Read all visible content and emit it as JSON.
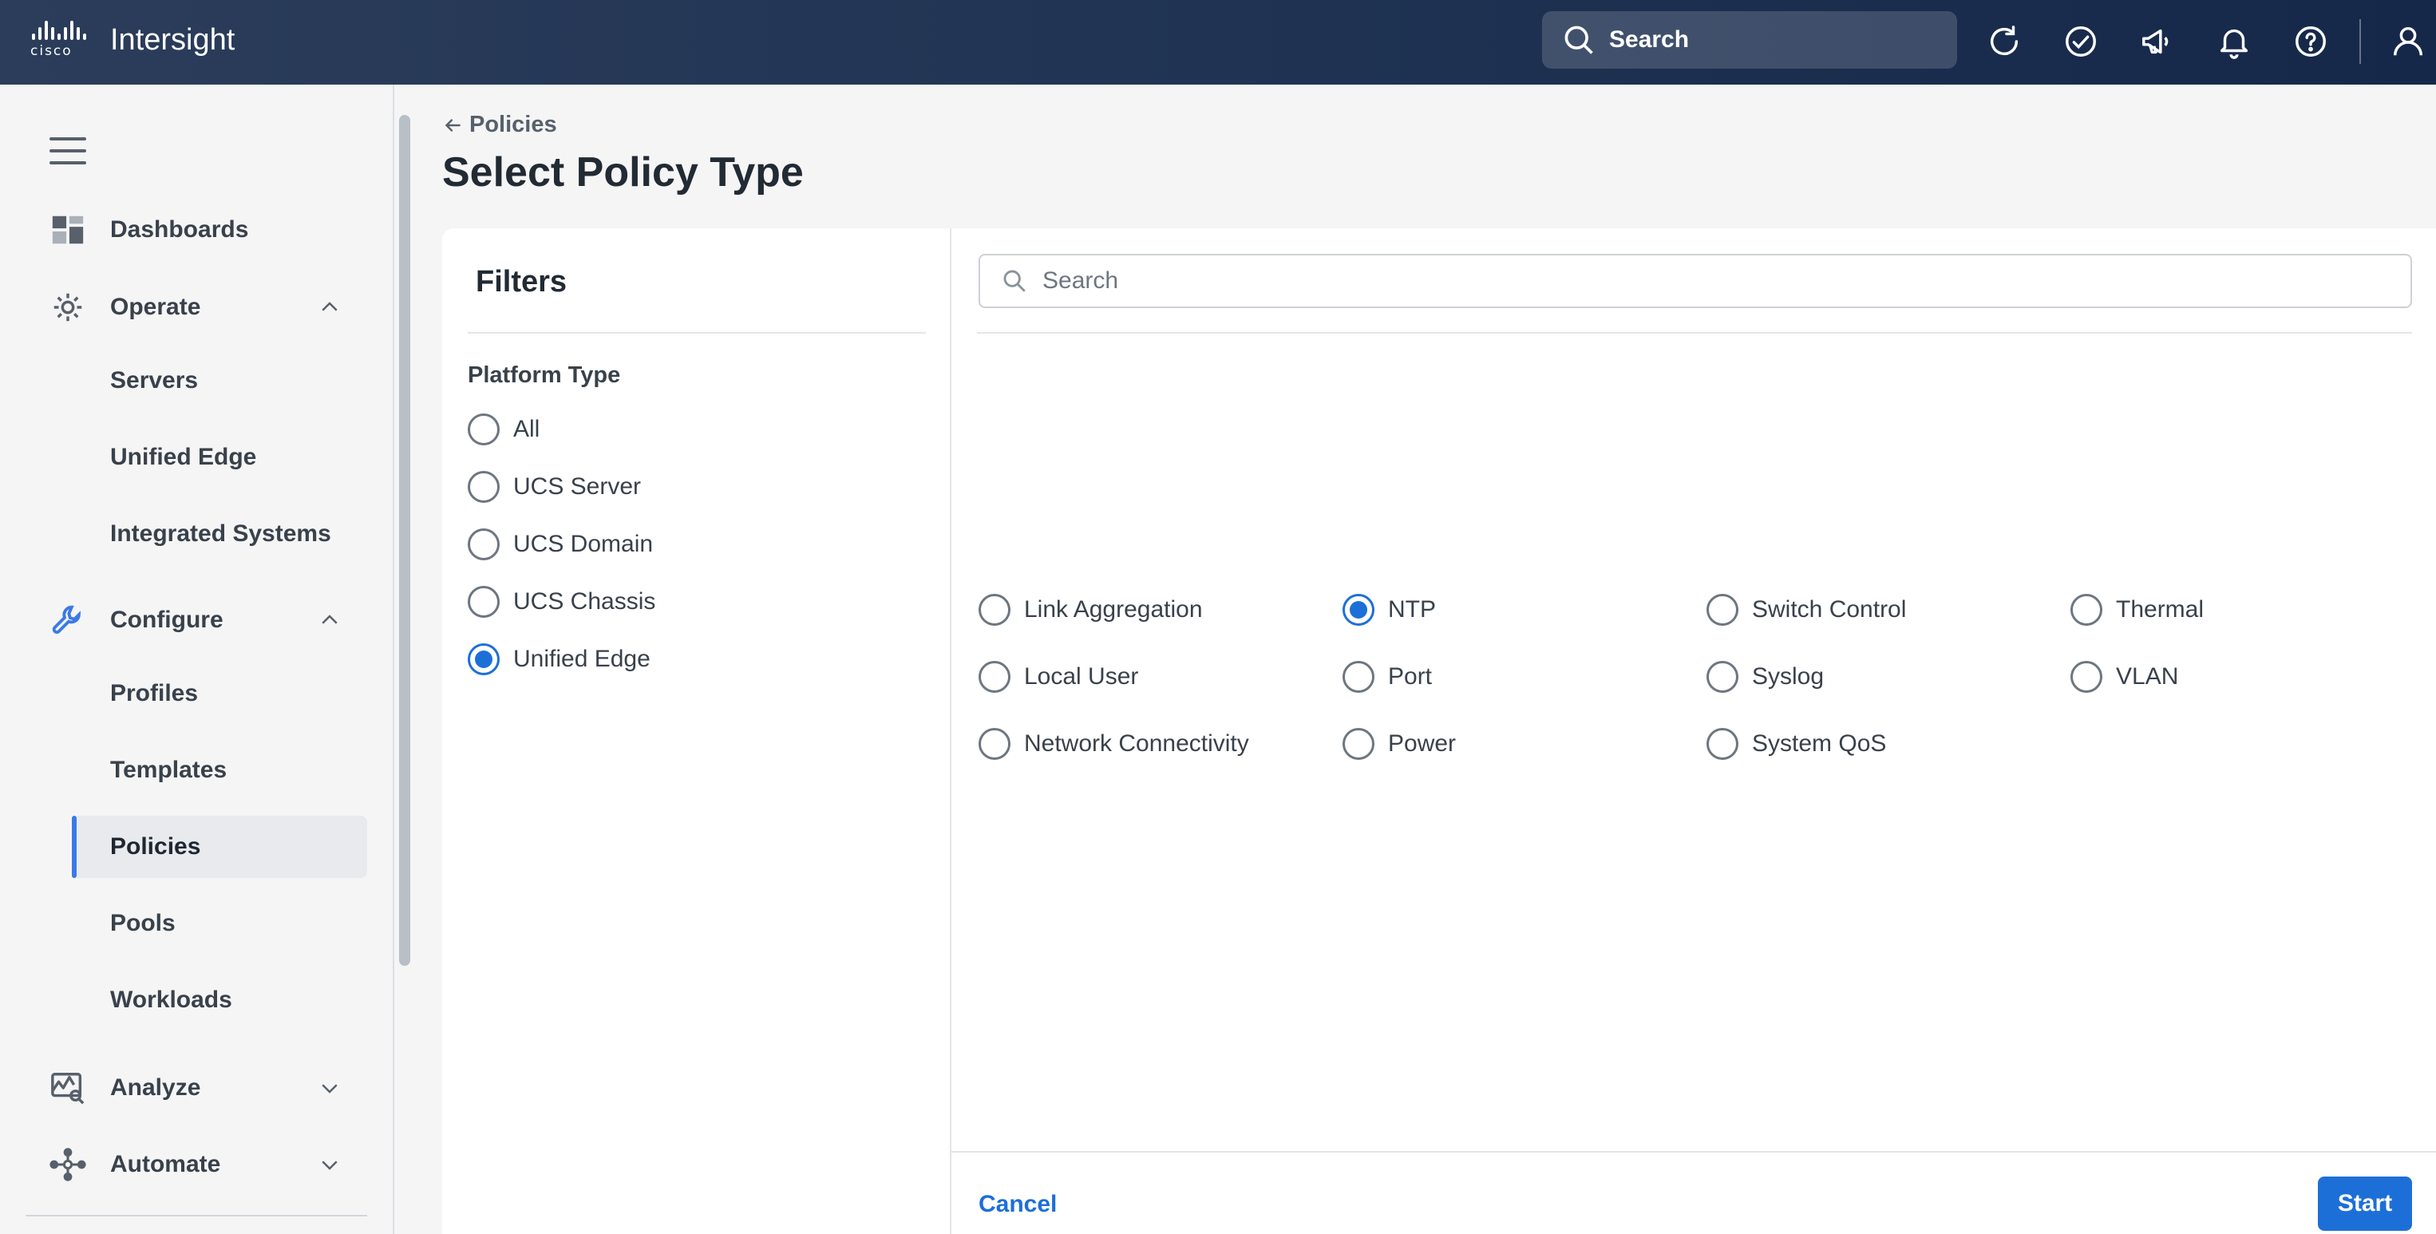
{
  "topbar": {
    "logo_text": "cisco",
    "app_name": "Intersight",
    "search_label": "Search",
    "icons": [
      "refresh-icon",
      "check-circle-icon",
      "megaphone-icon",
      "bell-icon",
      "help-icon",
      "user-icon"
    ]
  },
  "sidebar": {
    "dashboards": "Dashboards",
    "operate": "Operate",
    "operate_items": [
      "Servers",
      "Unified Edge",
      "Integrated Systems"
    ],
    "configure": "Configure",
    "configure_items": [
      "Profiles",
      "Templates",
      "Policies",
      "Pools",
      "Workloads"
    ],
    "active_item": "Policies",
    "analyze": "Analyze",
    "automate": "Automate"
  },
  "header": {
    "breadcrumb": "Policies",
    "title": "Select Policy Type"
  },
  "filters": {
    "title": "Filters",
    "group_label": "Platform Type",
    "options": [
      "All",
      "UCS Server",
      "UCS Domain",
      "UCS Chassis",
      "Unified Edge"
    ],
    "selected": "Unified Edge"
  },
  "policy_types": {
    "search_placeholder": "Search",
    "columns": [
      [
        "Link Aggregation",
        "Local User",
        "Network Connectivity"
      ],
      [
        "NTP",
        "Port",
        "Power"
      ],
      [
        "Switch Control",
        "Syslog",
        "System QoS"
      ],
      [
        "Thermal",
        "VLAN"
      ]
    ],
    "selected": "NTP"
  },
  "footer": {
    "cancel_label": "Cancel",
    "start_label": "Start"
  },
  "colors": {
    "topbar": "#1f3252",
    "accent": "#1d6fd8",
    "active_indicator": "#3b7ae6"
  }
}
